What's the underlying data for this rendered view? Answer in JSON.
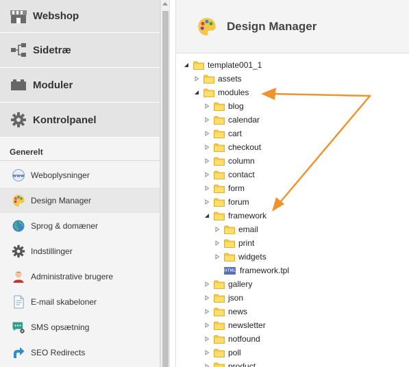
{
  "sidebar": {
    "main_items": [
      {
        "label": "Webshop",
        "icon": "shop-icon"
      },
      {
        "label": "Sidetræ",
        "icon": "sitemap-icon"
      },
      {
        "label": "Moduler",
        "icon": "modules-icon"
      },
      {
        "label": "Kontrolpanel",
        "icon": "gear-icon"
      }
    ],
    "section_title": "Generelt",
    "sub_items": [
      {
        "label": "Weboplysninger",
        "icon": "www-icon"
      },
      {
        "label": "Design Manager",
        "icon": "palette-icon",
        "active": true
      },
      {
        "label": "Sprog & domæner",
        "icon": "globe-icon"
      },
      {
        "label": "Indstillinger",
        "icon": "gear-icon"
      },
      {
        "label": "Administrative brugere",
        "icon": "user-icon"
      },
      {
        "label": "E-mail skabeloner",
        "icon": "document-icon"
      },
      {
        "label": "SMS opsætning",
        "icon": "sms-icon"
      },
      {
        "label": "SEO Redirects",
        "icon": "redirect-icon"
      }
    ]
  },
  "header": {
    "title": "Design Manager",
    "icon": "palette-icon"
  },
  "tree": {
    "nodes": [
      {
        "label": "template001_1",
        "state": "expanded",
        "type": "folder"
      },
      {
        "label": "assets",
        "state": "collapsed",
        "type": "folder"
      },
      {
        "label": "modules",
        "state": "expanded",
        "type": "folder"
      },
      {
        "label": "blog",
        "state": "collapsed",
        "type": "folder"
      },
      {
        "label": "calendar",
        "state": "collapsed",
        "type": "folder"
      },
      {
        "label": "cart",
        "state": "collapsed",
        "type": "folder"
      },
      {
        "label": "checkout",
        "state": "collapsed",
        "type": "folder"
      },
      {
        "label": "column",
        "state": "collapsed",
        "type": "folder"
      },
      {
        "label": "contact",
        "state": "collapsed",
        "type": "folder"
      },
      {
        "label": "form",
        "state": "collapsed",
        "type": "folder"
      },
      {
        "label": "forum",
        "state": "collapsed",
        "type": "folder"
      },
      {
        "label": "framework",
        "state": "expanded",
        "type": "folder"
      },
      {
        "label": "email",
        "state": "collapsed",
        "type": "folder"
      },
      {
        "label": "print",
        "state": "collapsed",
        "type": "folder"
      },
      {
        "label": "widgets",
        "state": "collapsed",
        "type": "folder"
      },
      {
        "label": "framework.tpl",
        "state": "leaf",
        "type": "file",
        "badge": "HTML"
      },
      {
        "label": "gallery",
        "state": "collapsed",
        "type": "folder"
      },
      {
        "label": "json",
        "state": "collapsed",
        "type": "folder"
      },
      {
        "label": "news",
        "state": "collapsed",
        "type": "folder"
      },
      {
        "label": "newsletter",
        "state": "collapsed",
        "type": "folder"
      },
      {
        "label": "notfound",
        "state": "collapsed",
        "type": "folder"
      },
      {
        "label": "poll",
        "state": "collapsed",
        "type": "folder"
      },
      {
        "label": "product",
        "state": "collapsed",
        "type": "folder"
      }
    ]
  },
  "colors": {
    "annotation_arrow": "#f0922e",
    "folder": "#f5c842",
    "sidebar_bg": "#f4f4f4"
  }
}
